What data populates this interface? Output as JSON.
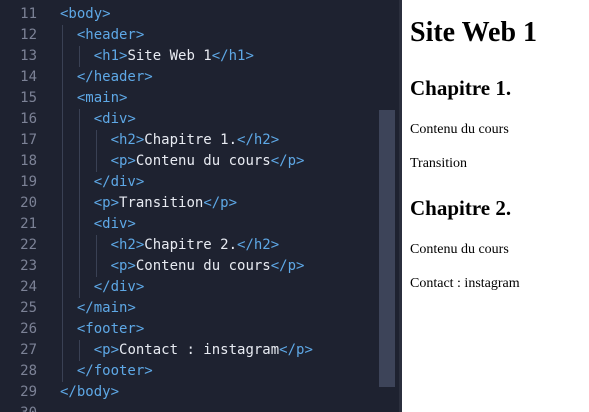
{
  "editor": {
    "lines": [
      {
        "num": "11",
        "parts": [
          {
            "c": "t",
            "v": "<body>"
          }
        ]
      },
      {
        "num": "12",
        "parts": [
          {
            "c": "t",
            "v": "<header>"
          }
        ]
      },
      {
        "num": "13",
        "parts": [
          {
            "c": "t",
            "v": "<h1>"
          },
          {
            "c": "txt",
            "v": "Site Web 1"
          },
          {
            "c": "t",
            "v": "</h1>"
          }
        ]
      },
      {
        "num": "14",
        "parts": [
          {
            "c": "t",
            "v": "</header>"
          }
        ]
      },
      {
        "num": "15",
        "parts": [
          {
            "c": "t",
            "v": "<main>"
          }
        ]
      },
      {
        "num": "16",
        "parts": [
          {
            "c": "t",
            "v": "<div>"
          }
        ]
      },
      {
        "num": "17",
        "parts": [
          {
            "c": "t",
            "v": "<h2>"
          },
          {
            "c": "txt",
            "v": "Chapitre 1."
          },
          {
            "c": "t",
            "v": "</h2>"
          }
        ]
      },
      {
        "num": "18",
        "parts": [
          {
            "c": "t",
            "v": "<p>"
          },
          {
            "c": "txt",
            "v": "Contenu du cours"
          },
          {
            "c": "t",
            "v": "</p>"
          }
        ]
      },
      {
        "num": "19",
        "parts": [
          {
            "c": "t",
            "v": "</div>"
          }
        ]
      },
      {
        "num": "20",
        "parts": [
          {
            "c": "t",
            "v": "<p>"
          },
          {
            "c": "txt",
            "v": "Transition"
          },
          {
            "c": "t",
            "v": "</p>"
          }
        ]
      },
      {
        "num": "21",
        "parts": [
          {
            "c": "t",
            "v": "<div>"
          }
        ]
      },
      {
        "num": "22",
        "parts": [
          {
            "c": "t",
            "v": "<h2>"
          },
          {
            "c": "txt",
            "v": "Chapitre 2."
          },
          {
            "c": "t",
            "v": "</h2>"
          }
        ]
      },
      {
        "num": "23",
        "parts": [
          {
            "c": "t",
            "v": "<p>"
          },
          {
            "c": "txt",
            "v": "Contenu du cours"
          },
          {
            "c": "t",
            "v": "</p>"
          }
        ]
      },
      {
        "num": "24",
        "parts": [
          {
            "c": "t",
            "v": "</div>"
          }
        ]
      },
      {
        "num": "25",
        "parts": [
          {
            "c": "t",
            "v": "</main>"
          }
        ]
      },
      {
        "num": "26",
        "parts": [
          {
            "c": "t",
            "v": "<footer>"
          }
        ]
      },
      {
        "num": "27",
        "parts": [
          {
            "c": "t",
            "v": "<p>"
          },
          {
            "c": "txt",
            "v": "Contact : instagram"
          },
          {
            "c": "t",
            "v": "</p>"
          }
        ]
      },
      {
        "num": "28",
        "parts": [
          {
            "c": "t",
            "v": "</footer>"
          }
        ]
      },
      {
        "num": "29",
        "parts": [
          {
            "c": "t",
            "v": "</body>"
          }
        ]
      },
      {
        "num": "30",
        "parts": []
      }
    ],
    "colors": {
      "background": "#1e2230",
      "tag": "#5ea8e6",
      "text": "#e8ebf2",
      "line_number": "#7c8296"
    }
  },
  "preview": {
    "title": "Site Web 1",
    "chapter1": "Chapitre 1.",
    "content1": "Contenu du cours",
    "transition": "Transition",
    "chapter2": "Chapitre 2.",
    "content2": "Contenu du cours",
    "contact": "Contact : instagram"
  }
}
